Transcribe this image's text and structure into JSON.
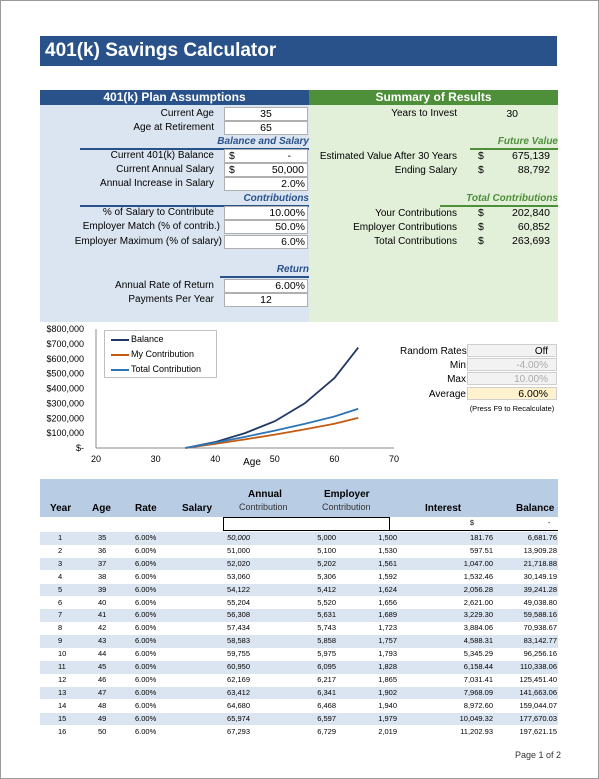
{
  "title": "401(k) Savings Calculator",
  "assumptions": {
    "header": "401(k) Plan Assumptions",
    "current_age_label": "Current Age",
    "current_age": "35",
    "retire_age_label": "Age at Retirement",
    "retire_age": "65",
    "balance_salary_header": "Balance and Salary",
    "balance_label": "Current 401(k) Balance",
    "balance_dollar": "$",
    "balance": "-",
    "salary_label": "Current Annual Salary",
    "salary_dollar": "$",
    "salary": "50,000",
    "increase_label": "Annual Increase in Salary",
    "increase": "2.0%",
    "contrib_header": "Contributions",
    "pct_salary_label": "% of Salary to Contribute",
    "pct_salary": "10.00%",
    "match_label": "Employer Match (% of contrib.)",
    "match": "50.0%",
    "max_label": "Employer Maximum (% of salary)",
    "max": "6.0%",
    "return_header": "Return",
    "rate_label": "Annual Rate of Return",
    "rate": "6.00%",
    "payments_label": "Payments Per Year",
    "payments": "12"
  },
  "summary": {
    "header": "Summary of Results",
    "years_label": "Years to Invest",
    "years": "30",
    "future_header": "Future Value",
    "est_label": "Estimated Value After 30 Years",
    "est_dollar": "$",
    "est_value": "675,139",
    "ending_label": "Ending Salary",
    "ending_dollar": "$",
    "ending_salary": "88,792",
    "total_header": "Total Contributions",
    "your_label": "Your Contributions",
    "your_dollar": "$",
    "your_value": "202,840",
    "employer_label": "Employer Contributions",
    "employer_dollar": "$",
    "employer_value": "60,852",
    "total_label": "Total Contributions",
    "total_dollar": "$",
    "total_value": "263,693"
  },
  "random": {
    "rates_label": "Random Rates",
    "rates_value": "Off",
    "min_label": "Min",
    "min_value": "-4.00%",
    "max_label": "Max",
    "max_value": "10.00%",
    "avg_label": "Average",
    "avg_value": "6.00%",
    "note": "(Press F9 to Recalculate)"
  },
  "chart_data": {
    "type": "line",
    "xlabel": "Age",
    "xlim": [
      20,
      70
    ],
    "ylim": [
      0,
      800000
    ],
    "xticks": [
      "20",
      "30",
      "40",
      "50",
      "60",
      "70"
    ],
    "yticks": [
      "$-",
      "$100,000",
      "$200,000",
      "$300,000",
      "$400,000",
      "$500,000",
      "$600,000",
      "$700,000",
      "$800,000"
    ],
    "x": [
      35,
      40,
      45,
      50,
      55,
      60,
      64
    ],
    "series": [
      {
        "name": "Balance",
        "color": "#1f3864",
        "values": [
          0,
          40000,
          100000,
          180000,
          300000,
          470000,
          675139
        ]
      },
      {
        "name": "My Contribution",
        "color": "#c55a11",
        "values": [
          0,
          28000,
          58000,
          90000,
          125000,
          163000,
          202840
        ]
      },
      {
        "name": "Total Contribution",
        "color": "#2e75b6",
        "values": [
          0,
          36000,
          75000,
          117000,
          162000,
          212000,
          263693
        ]
      }
    ]
  },
  "table": {
    "headers": {
      "year": "Year",
      "age": "Age",
      "rate": "Rate",
      "salary": "Salary",
      "annual": "Annual",
      "annual_sub": "Contribution",
      "employer": "Employer",
      "employer_sub": "Contribution",
      "interest": "Interest",
      "balance": "Balance"
    },
    "start": {
      "interest": "$",
      "balance": "-"
    },
    "rows": [
      [
        "1",
        "35",
        "6.00%",
        "50,000",
        "5,000",
        "1,500",
        "181.76",
        "6,681.76"
      ],
      [
        "2",
        "36",
        "6.00%",
        "51,000",
        "5,100",
        "1,530",
        "597.51",
        "13,909.28"
      ],
      [
        "3",
        "37",
        "6.00%",
        "52,020",
        "5,202",
        "1,561",
        "1,047.00",
        "21,718.88"
      ],
      [
        "4",
        "38",
        "6.00%",
        "53,060",
        "5,306",
        "1,592",
        "1,532.46",
        "30,149.19"
      ],
      [
        "5",
        "39",
        "6.00%",
        "54,122",
        "5,412",
        "1,624",
        "2,056.28",
        "39,241.28"
      ],
      [
        "6",
        "40",
        "6.00%",
        "55,204",
        "5,520",
        "1,656",
        "2,621.00",
        "49,038.80"
      ],
      [
        "7",
        "41",
        "6.00%",
        "56,308",
        "5,631",
        "1,689",
        "3,229.30",
        "59,588.16"
      ],
      [
        "8",
        "42",
        "6.00%",
        "57,434",
        "5,743",
        "1,723",
        "3,884.06",
        "70,938.67"
      ],
      [
        "9",
        "43",
        "6.00%",
        "58,583",
        "5,858",
        "1,757",
        "4,588.31",
        "83,142.77"
      ],
      [
        "10",
        "44",
        "6.00%",
        "59,755",
        "5,975",
        "1,793",
        "5,345.29",
        "96,256.16"
      ],
      [
        "11",
        "45",
        "6.00%",
        "60,950",
        "6,095",
        "1,828",
        "6,158.44",
        "110,338.06"
      ],
      [
        "12",
        "46",
        "6.00%",
        "62,169",
        "6,217",
        "1,865",
        "7,031.41",
        "125,451.40"
      ],
      [
        "13",
        "47",
        "6.00%",
        "63,412",
        "6,341",
        "1,902",
        "7,968.09",
        "141,663.06"
      ],
      [
        "14",
        "48",
        "6.00%",
        "64,680",
        "6,468",
        "1,940",
        "8,972.60",
        "159,044.07"
      ],
      [
        "15",
        "49",
        "6.00%",
        "65,974",
        "6,597",
        "1,979",
        "10,049.32",
        "177,670.03"
      ],
      [
        "16",
        "50",
        "6.00%",
        "67,293",
        "6,729",
        "2,019",
        "11,202.93",
        "197,621.15"
      ]
    ]
  },
  "footer": "Page 1 of 2"
}
